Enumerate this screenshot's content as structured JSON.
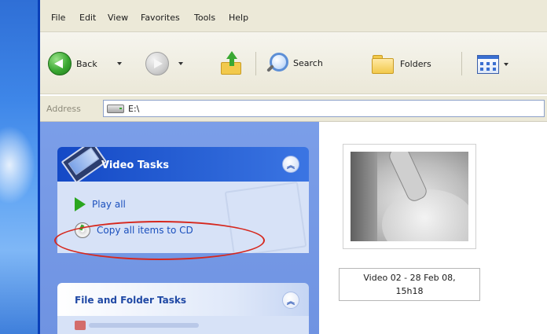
{
  "menubar": {
    "items": [
      "File",
      "Edit",
      "View",
      "Favorites",
      "Tools",
      "Help"
    ]
  },
  "toolbar": {
    "back_label": "Back",
    "search_label": "Search",
    "folders_label": "Folders"
  },
  "address": {
    "label": "Address",
    "value": "E:\\"
  },
  "video_tasks": {
    "title": "Video Tasks",
    "items": [
      {
        "label": "Play all",
        "icon": "play-icon"
      },
      {
        "label": "Copy all items to CD",
        "icon": "cd-icon"
      }
    ]
  },
  "file_tasks": {
    "title": "File and Folder Tasks"
  },
  "content": {
    "files": [
      {
        "name_line1": "Video 02 - 28 Feb 08,",
        "name_line2": "15h18"
      }
    ]
  },
  "colors": {
    "highlight": "#d6281e",
    "task_link": "#1a4fbd",
    "panel_header": "#1449c6"
  }
}
